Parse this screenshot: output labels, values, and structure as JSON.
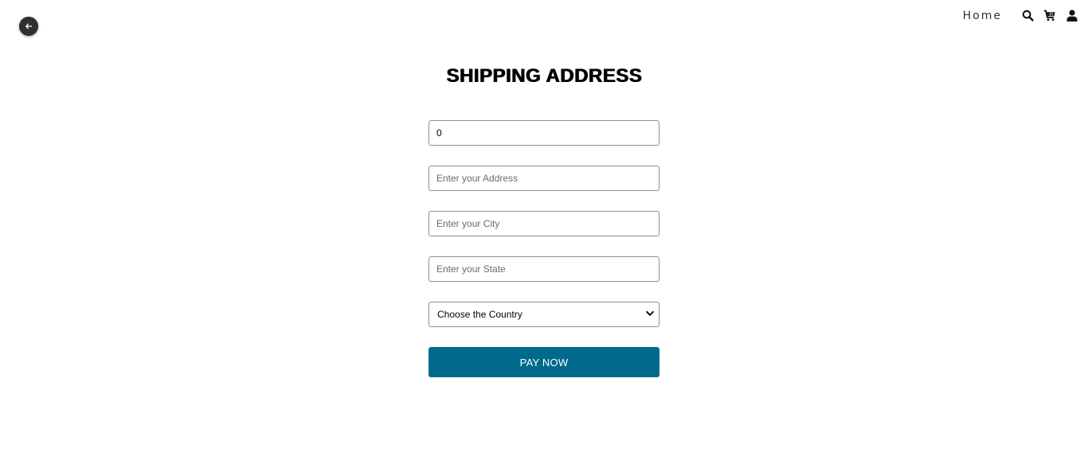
{
  "nav": {
    "back_icon": "arrow-left-icon",
    "home_label": "Home",
    "icons": [
      "search-icon",
      "cart-icon",
      "user-icon"
    ]
  },
  "page": {
    "title": "SHIPPING ADDRESS"
  },
  "form": {
    "phone_value": "0",
    "address_placeholder": "Enter your Address",
    "city_placeholder": "Enter your City",
    "state_placeholder": "Enter your State",
    "country_selected": "Choose the Country",
    "submit_label": "PAY NOW"
  },
  "colors": {
    "primary_button": "#006a8c",
    "back_button_bg": "#2f2f2f"
  }
}
